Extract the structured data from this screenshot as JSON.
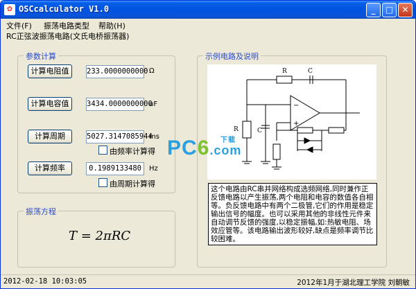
{
  "window": {
    "title": "OSCcalculator V1.0",
    "icon": "app-icon",
    "controls": {
      "minimize": "_",
      "maximize": "□",
      "close": "✕"
    }
  },
  "menu": [
    "文件(F)",
    "振荡电路类型",
    "帮助(H)"
  ],
  "circuit_label": "RC正弦波振荡电路(文氏电桥振荡器)",
  "params": {
    "group_title": "参数计算",
    "rows": [
      {
        "button": "计算电阻值",
        "value": "233.0000000000",
        "unit": "Ω"
      },
      {
        "button": "计算电容值",
        "value": "3434.0000000000",
        "unit": "uF"
      },
      {
        "button": "计算周期",
        "value": "5027.3147085944",
        "unit": "ms"
      },
      {
        "button": "计算频率",
        "value": "0.1989133480",
        "unit": "Hz"
      }
    ],
    "check_freq": "由频率计算得",
    "check_period": "由周期计算得"
  },
  "equation": {
    "group_title": "振荡方程",
    "formula": "T = 2πRC"
  },
  "example": {
    "group_title": "示例电路及说明",
    "labels": {
      "r_top": "R",
      "c_top": "C",
      "r_left": "R",
      "c_left": "C"
    },
    "watermark_a": "PC",
    "watermark_b": "6",
    "watermark_c": ".com",
    "watermark_tag": "下载",
    "description": "这个电路由RC串并网络构成选频网络,同时兼作正反馈电路以产生振荡,两个电阻和电容的数值各自相等。负反馈电路中有两个二极管,它们的作用是稳定输出信号的幅度。也可以采用其他的非线性元件来自动调节反馈的强度,以稳定振幅,如:热敏电阻、场效应管等。该电路输出波形较好,缺点是频率调节比较困难。"
  },
  "status": {
    "datetime": "2012-02-18 10:03:05",
    "credit": "2012年1月于湖北理工学院 刘朝敏"
  }
}
